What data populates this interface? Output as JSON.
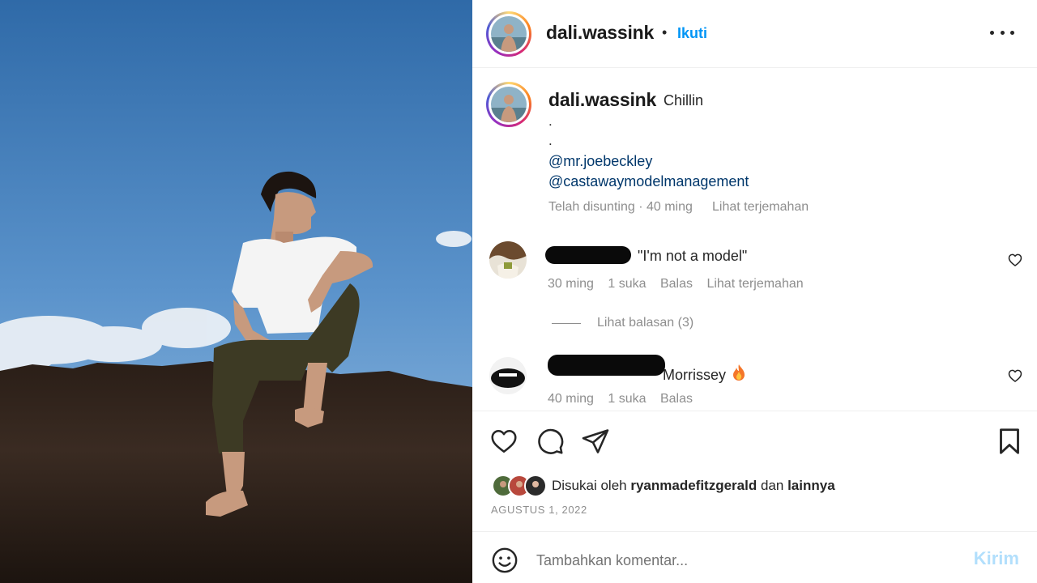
{
  "post": {
    "username": "dali.wassink",
    "separator": "•",
    "follow_label": "Ikuti",
    "more_icon": "more-horizontal-icon"
  },
  "caption": {
    "username": "dali.wassink",
    "text": "Chillin",
    "lines": [
      ".",
      "."
    ],
    "mentions": [
      "@mr.joebeckley",
      "@castawaymodelmanagement"
    ],
    "meta": "Telah disunting · 40 ming",
    "translate_label": "Lihat terjemahan"
  },
  "comments": [
    {
      "text": "\"I'm not a model\"",
      "time": "30 ming",
      "likes": "1 suka",
      "reply_label": "Balas",
      "translate_label": "Lihat terjemahan",
      "view_replies": "Lihat balasan (3)"
    },
    {
      "text": "Morrissey",
      "emoji": "fire-emoji",
      "time": "40 ming",
      "likes": "1 suka",
      "reply_label": "Balas"
    }
  ],
  "actions": {
    "like_icon": "heart-icon",
    "comment_icon": "comment-icon",
    "share_icon": "send-icon",
    "save_icon": "bookmark-icon"
  },
  "likes": {
    "prefix": "Disukai oleh",
    "user": "ryanmadefitzgerald",
    "conjunction": "dan",
    "others": "lainnya"
  },
  "date": "AGUSTUS 1, 2022",
  "comment_input": {
    "placeholder": "Tambahkan komentar...",
    "post_label": "Kirim"
  },
  "colors": {
    "accent": "#0095f6",
    "post_disabled": "#b2dffc",
    "mention": "#00376b",
    "muted": "#8e8e8e"
  }
}
